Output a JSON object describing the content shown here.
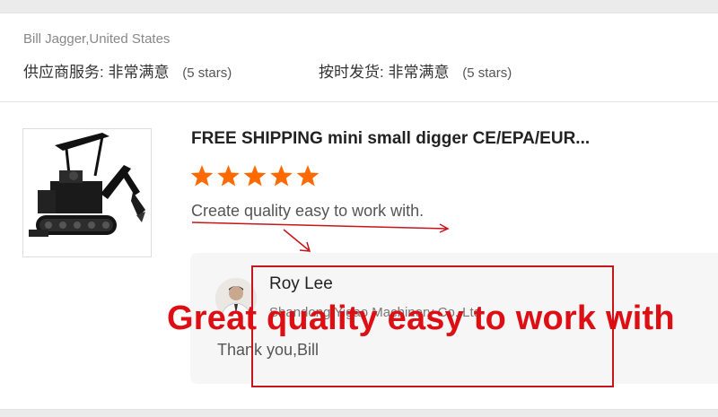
{
  "review_header": {
    "reviewer": "Bill Jagger,United States",
    "supplier_service": {
      "label": "供应商服务:",
      "value": "非常满意",
      "stars_note": "(5 stars)"
    },
    "on_time_delivery": {
      "label": "按时发货:",
      "value": "非常满意",
      "stars_note": "(5 stars)"
    }
  },
  "review": {
    "product_title": "FREE SHIPPING mini small digger CE/EPA/EUR...",
    "star_count": 5,
    "star_color": "#ff6a00",
    "text": "Create quality easy to work with."
  },
  "seller_reply": {
    "name": "Roy Lee",
    "company": "Shandong Yigao Machinery Co.,Ltd",
    "message": "Thank you,Bill"
  },
  "annotation": {
    "overlay_text": "Great quality easy to work with",
    "color": "#dd0f14"
  }
}
